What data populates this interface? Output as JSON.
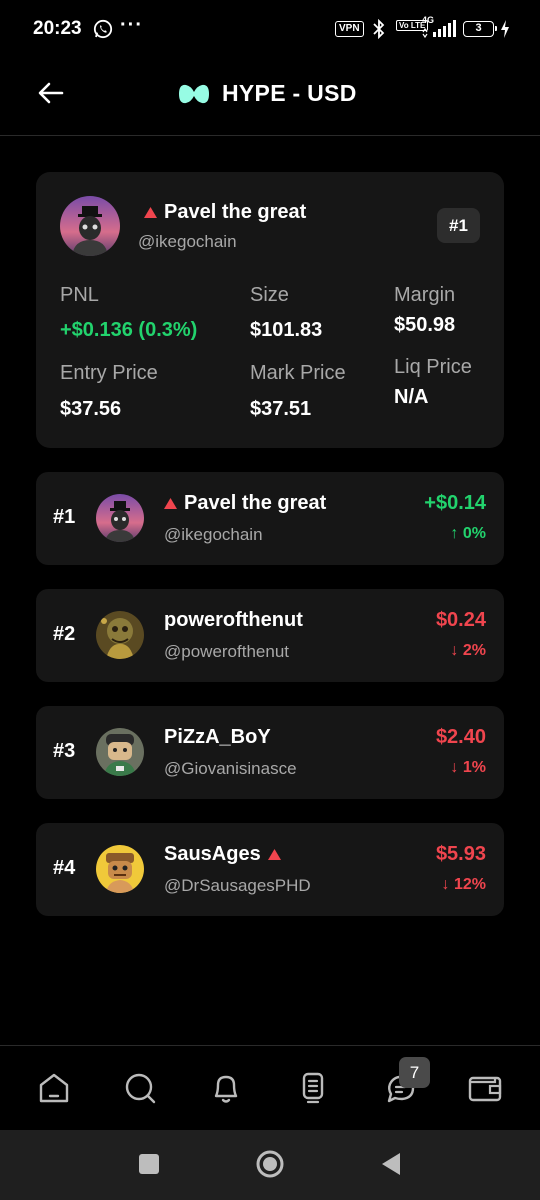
{
  "status_bar": {
    "time": "20:23",
    "dots": "···",
    "vpn": "VPN",
    "volte": "Vo LTE",
    "network": "4G",
    "battery": "3"
  },
  "header": {
    "title": "HYPE - USD",
    "logo_color": "#97fce4"
  },
  "position": {
    "name": "Pavel the great",
    "handle": "@ikegochain",
    "rank": "#1",
    "labels": {
      "pnl": "PNL",
      "size": "Size",
      "margin": "Margin",
      "entry_price": "Entry Price",
      "mark_price": "Mark Price",
      "liq_price": "Liq Price"
    },
    "values": {
      "pnl": "+$0.136 (0.3%)",
      "size": "$101.83",
      "margin": "$50.98",
      "entry_price": "$37.56",
      "mark_price": "$37.51",
      "liq_price": "N/A"
    }
  },
  "leaderboard": [
    {
      "rank": "#1",
      "name": "Pavel the great",
      "handle": "@ikegochain",
      "value": "+$0.14",
      "change": "↑ 0%",
      "trend": "up",
      "flag": true,
      "flag_after": false
    },
    {
      "rank": "#2",
      "name": "powerofthenut",
      "handle": "@powerofthenut",
      "value": "$0.24",
      "change": "↓ 2%",
      "trend": "down",
      "flag": false,
      "flag_after": false
    },
    {
      "rank": "#3",
      "name": "PiZzA_BoY",
      "handle": "@Giovanisinasce",
      "value": "$2.40",
      "change": "↓ 1%",
      "trend": "down",
      "flag": false,
      "flag_after": false
    },
    {
      "rank": "#4",
      "name": "SausAges",
      "handle": "@DrSausagesPHD",
      "value": "$5.93",
      "change": "↓ 12%",
      "trend": "down",
      "flag": true,
      "flag_after": true
    }
  ],
  "bottom_nav": {
    "items": [
      "home-icon",
      "search-icon",
      "bell-icon",
      "portfolio-icon",
      "chat-icon",
      "wallet-icon"
    ],
    "chat_badge": "7"
  },
  "colors": {
    "positive": "#22d36d",
    "negative": "#f0454e",
    "card": "#161616",
    "flag": "#f0454e"
  }
}
